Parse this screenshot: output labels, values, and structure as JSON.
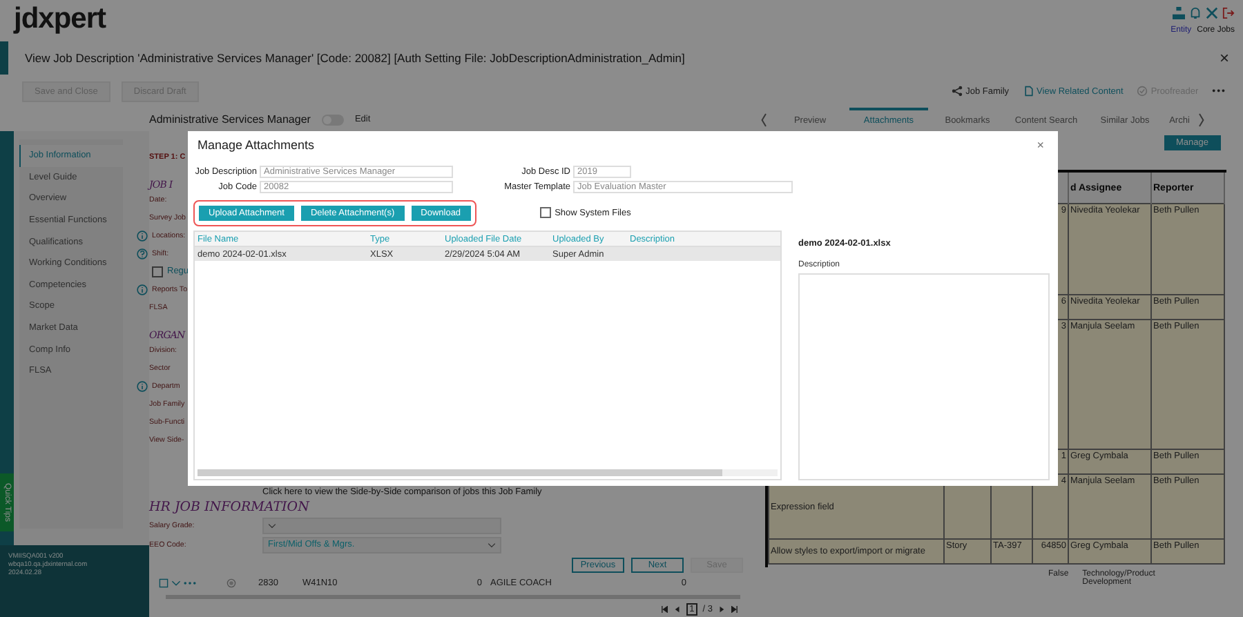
{
  "header": {
    "logo": "jdxpert",
    "links": [
      {
        "label": "Entity",
        "kind": "entity"
      },
      {
        "label": "Core Jobs",
        "kind": "plain"
      }
    ]
  },
  "title_bar": {
    "title": "View Job Description 'Administrative Services Manager'  [Code: 20082] [Auth Setting File: JobDescriptionAdministration_Admin]",
    "close": "×"
  },
  "toolbar": {
    "left": [
      {
        "label": "Save and Close",
        "disabled": true
      },
      {
        "label": "Discard Draft",
        "disabled": true
      }
    ],
    "right": [
      {
        "label": "Job Family",
        "kind": "family",
        "disabled": false
      },
      {
        "label": "View Related Content",
        "kind": "document",
        "disabled": false
      },
      {
        "label": "Proofreader",
        "kind": "check",
        "disabled": true
      }
    ],
    "more": "•••"
  },
  "job": {
    "name": "Administrative Services Manager",
    "edit_label": "Edit",
    "edit_on": false
  },
  "sidebar": {
    "items": [
      {
        "label": "Job Information",
        "selected": true
      },
      {
        "label": "Level Guide",
        "selected": false
      },
      {
        "label": "Overview",
        "selected": false
      },
      {
        "label": "Essential Functions",
        "selected": false
      },
      {
        "label": "Qualifications",
        "selected": false
      },
      {
        "label": "Working Conditions",
        "selected": false
      },
      {
        "label": "Competencies",
        "selected": false
      },
      {
        "label": "Scope",
        "selected": false
      },
      {
        "label": "Market Data",
        "selected": false
      },
      {
        "label": "Comp Info",
        "selected": false
      },
      {
        "label": "FLSA",
        "selected": false
      }
    ],
    "quick_tips": "Quick Tips",
    "version": [
      "VMIISQA001 v200",
      "wbqa10.qa.jdxinternal.com",
      "2024.02.28"
    ]
  },
  "form": {
    "items": [
      {
        "kind": "step",
        "text": "STEP 1:  C"
      },
      {
        "kind": "heading",
        "text": "JOB I"
      },
      {
        "kind": "label",
        "text": "Date:"
      },
      {
        "kind": "label",
        "text": "Survey Job"
      },
      {
        "kind": "info",
        "text": "Locations:"
      },
      {
        "kind": "help",
        "text": "Shift:"
      },
      {
        "kind": "checkbox",
        "text": "Regu",
        "checked": false
      },
      {
        "kind": "info",
        "text": "Reports To"
      },
      {
        "kind": "label",
        "text": "FLSA"
      },
      {
        "kind": "heading",
        "text": "ORGAN"
      },
      {
        "kind": "label",
        "text": "Division:"
      },
      {
        "kind": "label",
        "text": "Sector"
      },
      {
        "kind": "info",
        "text": "Departm"
      },
      {
        "kind": "label",
        "text": "Job Family"
      },
      {
        "kind": "label",
        "text": "Sub-Functi"
      },
      {
        "kind": "label",
        "text": "View Side-"
      }
    ],
    "link": "Click here to view the Side-by-Side comparison of jobs this Job Family",
    "hr_heading": "HR JOB INFORMATION",
    "selects": [
      {
        "label": "Salary Grade:"
      },
      {
        "label": "EEO Code:",
        "value": "First/Mid Offs & Mgrs."
      }
    ],
    "buttons": [
      {
        "label": "Previous",
        "disabled": false
      },
      {
        "label": "Next",
        "disabled": false
      },
      {
        "label": "Save",
        "disabled": true
      }
    ]
  },
  "bottom_row": {
    "cells": [
      "2830",
      "W41N10",
      "0",
      "AGILE COACH",
      "0"
    ],
    "pager": {
      "page": "1",
      "total": "/ 3"
    }
  },
  "right_panel": {
    "tabs": [
      {
        "label": "Preview",
        "selected": false
      },
      {
        "label": "Attachments",
        "selected": true
      },
      {
        "label": "Bookmarks",
        "selected": false
      },
      {
        "label": "Content Search",
        "selected": false
      },
      {
        "label": "Similar Jobs",
        "selected": false
      },
      {
        "label": "Archi",
        "selected": false
      }
    ],
    "manage": "Manage",
    "table": {
      "columns": {
        "assignee": "d Assignee",
        "reporter": "Reporter"
      },
      "rows": [
        {
          "column_4": "9",
          "assignee": "Nivedita Yeolekar",
          "reporter": "Beth Pullen"
        },
        {
          "column_4": "6",
          "assignee": "Nivedita Yeolekar",
          "reporter": "Beth Pullen"
        },
        {
          "column_4": "3",
          "assignee": "Manjula Seelam",
          "reporter": "Beth Pullen"
        },
        {
          "column_4": "1",
          "assignee": "Greg Cymbala",
          "reporter": "Beth Pullen"
        },
        {
          "column_1": "Expression field",
          "column_4": "4",
          "assignee": "Manjula Seelam",
          "reporter": "Beth Pullen"
        },
        {
          "column_1": "Allow styles to export/import or migrate",
          "column_2": "Story",
          "column_3": "TA-397",
          "column_4": "64850",
          "assignee": "Greg Cymbala",
          "reporter": "Beth Pullen"
        }
      ]
    },
    "bottom_cells": [
      "False",
      "Technology/Product Development"
    ]
  },
  "dialog": {
    "title": "Manage Attachments",
    "close": "×",
    "fields": [
      {
        "label": "Job Description",
        "value": "Administrative Services Manager"
      },
      {
        "label": "Job Desc ID",
        "value": "2019"
      },
      {
        "label": "Job Code",
        "value": "20082"
      },
      {
        "label": "Master Template",
        "value": "Job Evaluation Master"
      }
    ],
    "buttons": [
      "Upload Attachment",
      "Delete Attachment(s)",
      "Download"
    ],
    "show_system_files": {
      "label": "Show System Files",
      "checked": false
    },
    "columns": [
      "File Name",
      "Type",
      "Uploaded File Date",
      "Uploaded By",
      "Description"
    ],
    "rows": [
      {
        "cells": [
          "demo 2024-02-01.xlsx",
          "XLSX",
          "2/29/2024 5:04 AM",
          "Super Admin"
        ],
        "selected": true
      }
    ],
    "detail": {
      "file_name": "demo 2024-02-01.xlsx",
      "description_label": "Description"
    }
  }
}
